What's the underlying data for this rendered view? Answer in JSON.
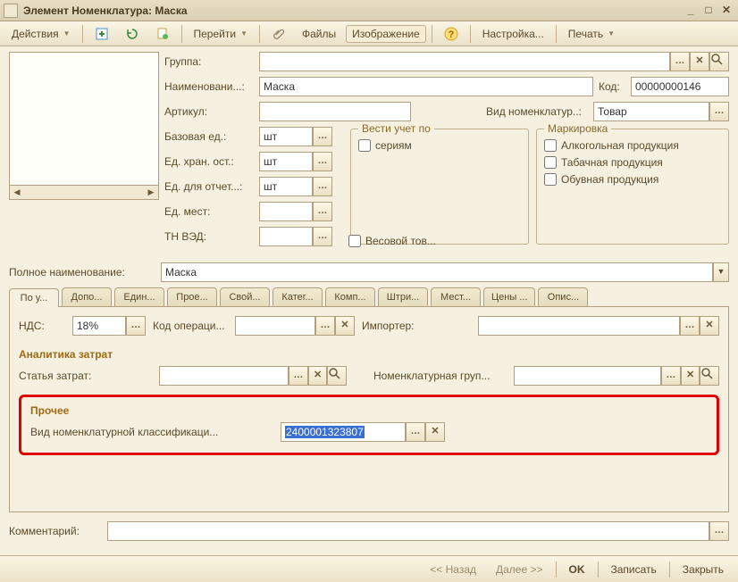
{
  "titlebar": {
    "title": "Элемент Номенклатура: Маска"
  },
  "toolbar": {
    "actions": "Действия",
    "go": "Перейти",
    "files": "Файлы",
    "image": "Изображение",
    "settings": "Настройка...",
    "print": "Печать"
  },
  "labels": {
    "group": "Группа:",
    "name": "Наименовани...:",
    "code": "Код:",
    "article": "Артикул:",
    "nom_type": "Вид номенклатур..:",
    "base_unit": "Базовая ед.:",
    "store_unit": "Ед. хран. ост.:",
    "report_unit": "Ед. для отчет...:",
    "place_unit": "Ед. мест:",
    "tnved": "ТН ВЭД:",
    "weight": "Весовой тов...",
    "full_name": "Полное наименование:",
    "accounting": "Вести учет по",
    "by_series": "сериям",
    "marking": "Маркировка",
    "alcohol": "Алкогольная продукция",
    "tobacco": "Табачная продукция",
    "shoes": "Обувная продукция",
    "vat": "НДС:",
    "op_code": "Код операци...",
    "importer": "Импортер:",
    "cost_analytics": "Аналитика затрат",
    "cost_item": "Статья затрат:",
    "nom_group": "Номенклатурная груп...",
    "other": "Прочее",
    "nom_class": "Вид номенклатурной классификаци...",
    "comment": "Комментарий:"
  },
  "values": {
    "name": "Маска",
    "code": "00000000146",
    "article": "",
    "nom_type": "Товар",
    "base_unit": "шт",
    "store_unit": "шт",
    "report_unit": "шт",
    "full_name": "Маска",
    "vat": "18%",
    "nom_class": "2400001323807"
  },
  "tabs": [
    "По у...",
    "Допо...",
    "Един...",
    "Прое...",
    "Свой...",
    "Катег...",
    "Комп...",
    "Штри...",
    "Мест...",
    "Цены ...",
    "Опис..."
  ],
  "bottom": {
    "back": "<< Назад",
    "next": "Далее >>",
    "ok": "OK",
    "save": "Записать",
    "close": "Закрыть"
  }
}
